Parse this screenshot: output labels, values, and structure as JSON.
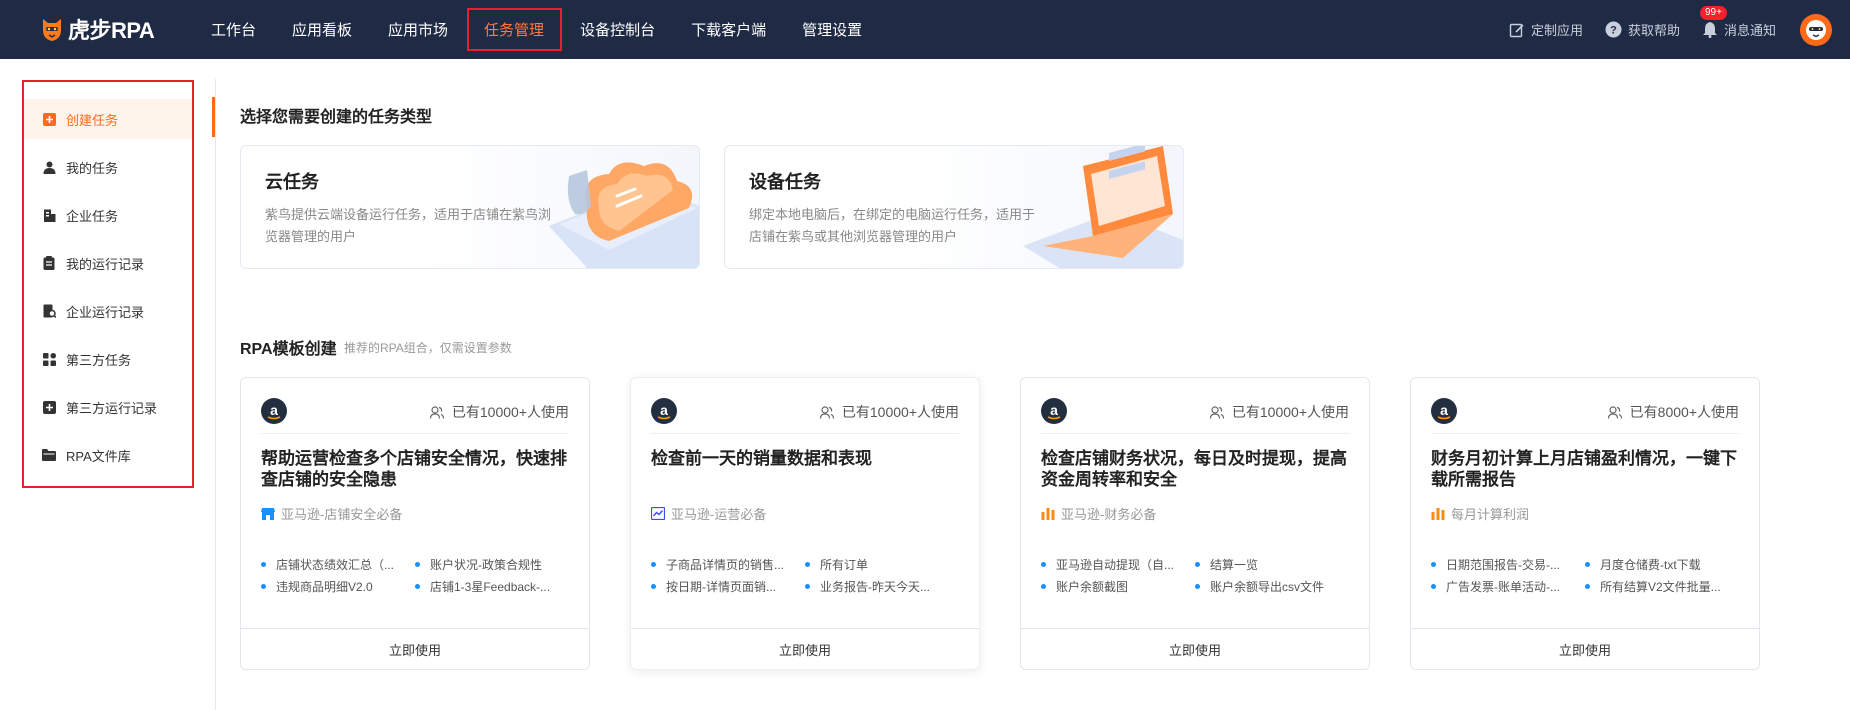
{
  "brand": {
    "name": "虎步RPA"
  },
  "nav": {
    "items": [
      "工作台",
      "应用看板",
      "应用市场",
      "任务管理",
      "设备控制台",
      "下载客户端",
      "管理设置"
    ],
    "active": "任务管理"
  },
  "header_right": {
    "custom_app": "定制应用",
    "help": "获取帮助",
    "notifications": "消息通知",
    "badge": "99+"
  },
  "sidebar": {
    "items": [
      {
        "label": "创建任务",
        "icon": "plus-square-icon"
      },
      {
        "label": "我的任务",
        "icon": "user-icon"
      },
      {
        "label": "企业任务",
        "icon": "building-icon"
      },
      {
        "label": "我的运行记录",
        "icon": "clipboard-icon"
      },
      {
        "label": "企业运行记录",
        "icon": "file-search-icon"
      },
      {
        "label": "第三方任务",
        "icon": "grid-icon"
      },
      {
        "label": "第三方运行记录",
        "icon": "plus-square-icon"
      },
      {
        "label": "RPA文件库",
        "icon": "folder-icon"
      }
    ],
    "active": "创建任务"
  },
  "main": {
    "select_title": "选择您需要创建的任务类型",
    "task_types": [
      {
        "title": "云任务",
        "desc": "紫鸟提供云端设备运行任务，适用于店铺在紫鸟浏览器管理的用户"
      },
      {
        "title": "设备任务",
        "desc": "绑定本地电脑后，在绑定的电脑运行任务，适用于店铺在紫鸟或其他浏览器管理的用户"
      }
    ],
    "rpa_title": "RPA模板创建",
    "rpa_subtitle": "推荐的RPA组合，仅需设置参数",
    "templates": [
      {
        "users": "已有10000+人使用",
        "title": "帮助运营检查多个店铺安全情况，快速排查店铺的安全隐患",
        "tag": "亚马逊-店铺安全必备",
        "tag_icon": "shop-icon",
        "tag_color": "#1890ff",
        "bullets": [
          "店铺状态绩效汇总（...",
          "账户状况-政策合规性",
          "违规商品明细V2.0",
          "店铺1-3星Feedback-..."
        ],
        "button": "立即使用"
      },
      {
        "users": "已有10000+人使用",
        "title": "检查前一天的销量数据和表现",
        "tag": "亚马逊-运营必备",
        "tag_icon": "chart-icon",
        "tag_color": "#2f54eb",
        "bullets": [
          "子商品详情页的销售...",
          "所有订单",
          "按日期-详情页面销...",
          "业务报告-昨天今天..."
        ],
        "button": "立即使用"
      },
      {
        "users": "已有10000+人使用",
        "title": "检查店铺财务状况，每日及时提现，提高资金周转率和安全",
        "tag": "亚马逊-财务必备",
        "tag_icon": "bar-chart-icon",
        "tag_color": "#fa8c16",
        "bullets": [
          "亚马逊自动提现（自...",
          "结算一览",
          "账户余额截图",
          "账户余额导出csv文件"
        ],
        "button": "立即使用"
      },
      {
        "users": "已有8000+人使用",
        "title": "财务月初计算上月店铺盈利情况，一键下载所需报告",
        "tag": "每月计算利润",
        "tag_icon": "bar-chart-icon",
        "tag_color": "#fa8c16",
        "bullets": [
          "日期范围报告-交易-...",
          "月度仓储费-txt下载",
          "广告发票-账单活动-...",
          "所有结算V2文件批量..."
        ],
        "button": "立即使用"
      }
    ]
  }
}
